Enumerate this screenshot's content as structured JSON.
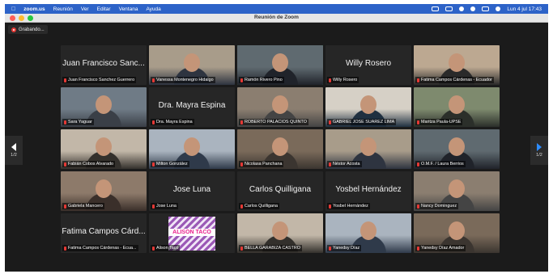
{
  "menubar": {
    "app": "zoom.us",
    "items": [
      "Reunión",
      "Ver",
      "Editar",
      "Ventana",
      "Ayuda"
    ],
    "clock": "Lun 4 jul  17:43"
  },
  "window": {
    "title": "Reunión de Zoom"
  },
  "recording": {
    "label": "Grabando..."
  },
  "pager": {
    "left_page": "1/2",
    "right_page": "1/2"
  },
  "participants": [
    {
      "name": "Juan Francisco Sanchez Guerrero",
      "display": "Juan Francisco Sanc...",
      "video": false
    },
    {
      "name": "Vanessa Montenegro Hidalgo",
      "video": true
    },
    {
      "name": "Ramón Rivero Pino",
      "video": true,
      "active": true
    },
    {
      "name": "Willy Rosero",
      "display": "Willy Rosero",
      "video": false
    },
    {
      "name": "Fatima Campos Cárdenas - Ecuador",
      "video": true
    },
    {
      "name": "Sara Yaguar",
      "video": true
    },
    {
      "name": "Dra. Mayra Espina",
      "display": "Dra. Mayra Espina",
      "video": false
    },
    {
      "name": "ROBERTO PALACIOS QUINTO",
      "video": true
    },
    {
      "name": "GABRIEL JOSE SUAREZ LIMA",
      "video": true
    },
    {
      "name": "Maritza Paula-UPSE",
      "video": true
    },
    {
      "name": "Fabián Cobos Alvarado",
      "video": true
    },
    {
      "name": "Milton González",
      "video": true
    },
    {
      "name": "Nicolasa Panchana",
      "video": true
    },
    {
      "name": "Néstor Acosta",
      "video": true
    },
    {
      "name": "O.M.F. / Laura Berrios",
      "video": true
    },
    {
      "name": "Gabriela Mancero",
      "video": true
    },
    {
      "name": "Jose Luna",
      "display": "Jose Luna",
      "video": false
    },
    {
      "name": "Carlos Quilligana",
      "display": "Carlos Quilligana",
      "video": false
    },
    {
      "name": "Yosbel Hernández",
      "display": "Yosbel Hernández",
      "video": false
    },
    {
      "name": "Nancy Dominguez",
      "video": true
    },
    {
      "name": "Fatima Campos Cárdenas - Ecua...",
      "display": "Fatima Campos Cárd...",
      "video": false
    },
    {
      "name": "Alison Taco",
      "video": true,
      "logo": "ALISON TACO"
    },
    {
      "name": "BELLA GARABIZA CASTRO",
      "video": true
    },
    {
      "name": "Yanedsy Díaz",
      "video": true
    },
    {
      "name": "Yanedsy Díaz Amador",
      "video": true
    }
  ],
  "colors": {
    "menubar": "#2d63c8",
    "active_speaker": "#31c15a",
    "mute": "#e53935",
    "nav_arrow": "#2d8cff"
  }
}
